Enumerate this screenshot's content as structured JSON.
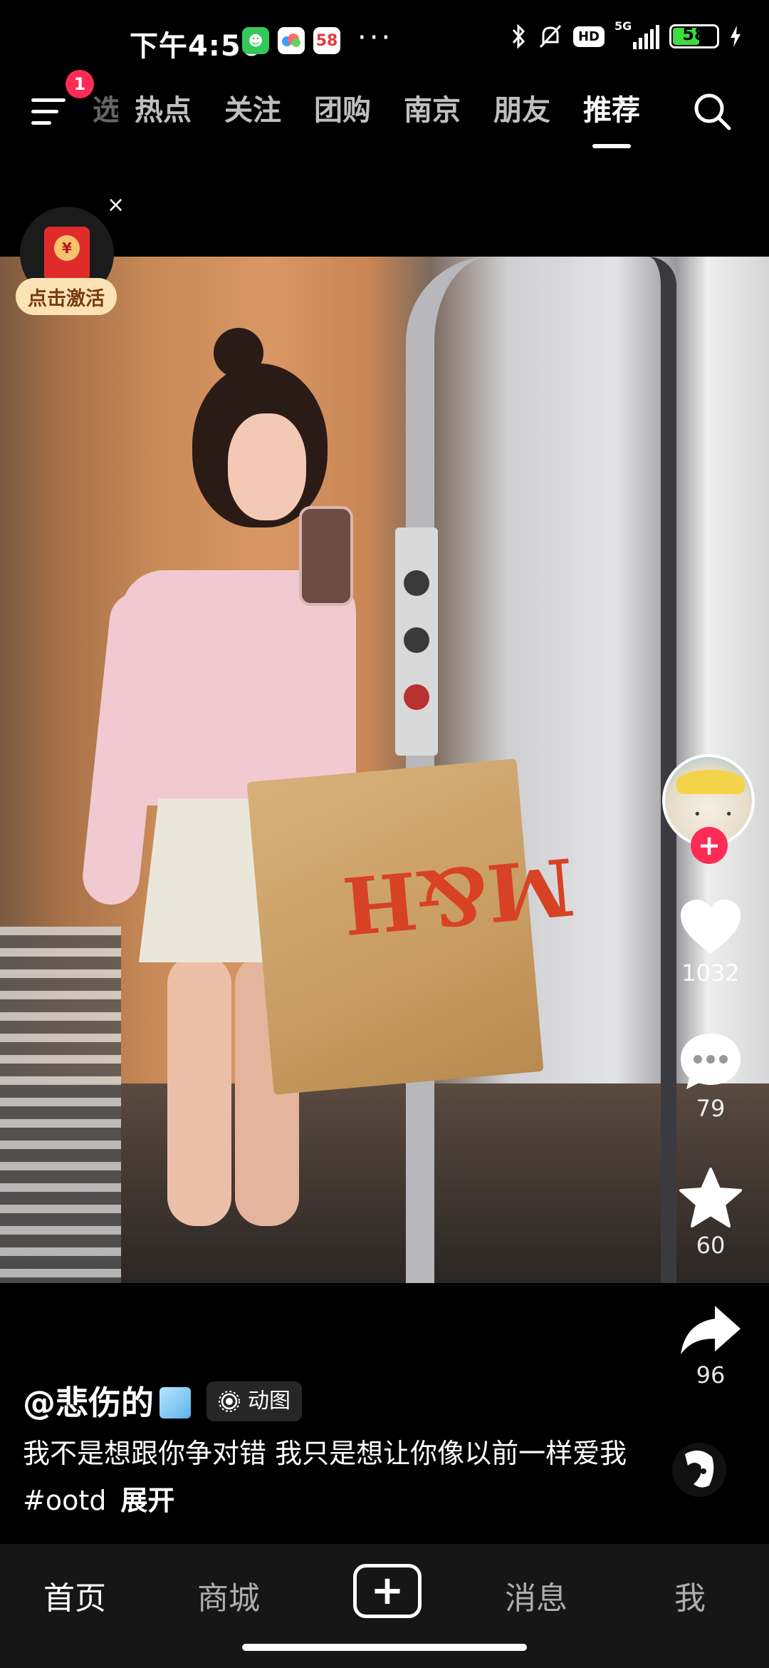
{
  "status_bar": {
    "time": "下午4:56",
    "app_badges": [
      "green-app-icon",
      "cloud-app-icon",
      "58-app-icon"
    ],
    "badge_58": "58",
    "more": "···",
    "network": "5G",
    "hd": "HD",
    "battery": "58"
  },
  "top_nav": {
    "menu_badge": "1",
    "tabs": [
      {
        "label": "选",
        "partial": true
      },
      {
        "label": "热点"
      },
      {
        "label": "关注"
      },
      {
        "label": "团购"
      },
      {
        "label": "南京"
      },
      {
        "label": "朋友"
      },
      {
        "label": "推荐",
        "active": true
      }
    ]
  },
  "redpacket": {
    "coin": "¥",
    "close": "×",
    "label": "点击激活"
  },
  "actions": {
    "follow": "+",
    "likes": "1032",
    "comments": "79",
    "favorites": "60",
    "shares": "96"
  },
  "post": {
    "author": "@悲伤的",
    "tag": "动图",
    "caption": "我不是想跟你争对错 我只是想让你像以前一样爱我#ootd",
    "expand": "展开"
  },
  "photo": {
    "bag_logo": "M&H"
  },
  "bottom_nav": {
    "home": "首页",
    "mall": "商城",
    "plus": "+",
    "messages": "消息",
    "me": "我"
  },
  "colors": {
    "accent": "#fe2c55",
    "background": "#000000",
    "bottom_bar": "#161616"
  }
}
